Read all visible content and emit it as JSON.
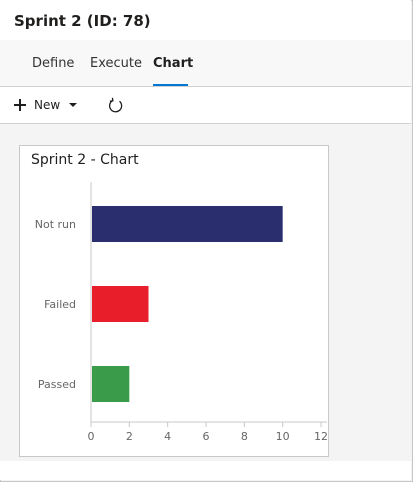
{
  "header": {
    "title": "Sprint 2 (ID: 78)"
  },
  "tabs": [
    {
      "label": "Define",
      "active": false
    },
    {
      "label": "Execute",
      "active": false
    },
    {
      "label": "Chart",
      "active": true
    }
  ],
  "toolbar": {
    "new_label": "New",
    "new_icon": "plus-icon",
    "dropdown_icon": "caret-down-icon",
    "refresh_icon": "refresh-icon"
  },
  "colors": {
    "accent": "#0078d4",
    "not_run": "#2b2e6e",
    "failed": "#e81e2a",
    "passed": "#3a9b4a"
  },
  "chart_data": {
    "type": "bar",
    "orientation": "horizontal",
    "title": "Sprint 2 - Chart",
    "categories": [
      "Not run",
      "Failed",
      "Passed"
    ],
    "values": [
      10,
      3,
      2
    ],
    "bar_colors": [
      "#2b2e6e",
      "#e81e2a",
      "#3a9b4a"
    ],
    "xlim": [
      0,
      12
    ],
    "x_ticks": [
      0,
      2,
      4,
      6,
      8,
      10,
      12
    ],
    "xlabel": "",
    "ylabel": "",
    "grid": false,
    "legend": "none"
  }
}
